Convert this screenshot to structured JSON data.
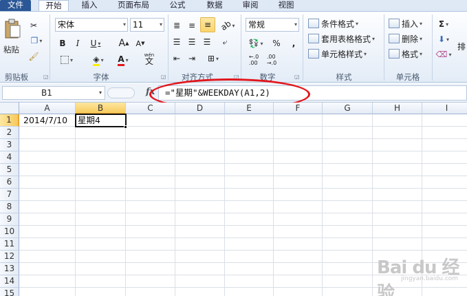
{
  "tabs": [
    "文件",
    "开始",
    "插入",
    "页面布局",
    "公式",
    "数据",
    "审阅",
    "视图"
  ],
  "ribbon": {
    "clipboard": {
      "paste": "粘贴",
      "label": "剪贴板"
    },
    "font": {
      "name": "宋体",
      "size": "11",
      "label": "字体"
    },
    "alignment": {
      "label": "对齐方式"
    },
    "number": {
      "format": "常规",
      "label": "数字",
      "percent": "%",
      "comma": ","
    },
    "styles": {
      "conditional": "条件格式",
      "table": "套用表格格式",
      "cell": "单元格样式",
      "label": "样式"
    },
    "cells": {
      "insert": "插入",
      "delete": "删除",
      "format": "格式",
      "label": "单元格"
    },
    "editing": {
      "sigma": "Σ",
      "sort": "排"
    }
  },
  "formula_bar": {
    "name_box": "B1",
    "fx": "fx",
    "formula": "=\"星期\"&WEEKDAY(A1,2)"
  },
  "columns": [
    "A",
    "B",
    "C",
    "D",
    "E",
    "F",
    "G",
    "H",
    "I"
  ],
  "rows": [
    "1",
    "2",
    "3",
    "4",
    "5",
    "6",
    "7",
    "8",
    "9",
    "10",
    "11",
    "12",
    "13",
    "14",
    "15"
  ],
  "cells": {
    "A1": "2014/7/10",
    "B1": "星期4"
  },
  "annotation_color": "#e2161c",
  "watermark": {
    "text": "Bai du 经验",
    "sub": "jingyan.baidu.com"
  }
}
